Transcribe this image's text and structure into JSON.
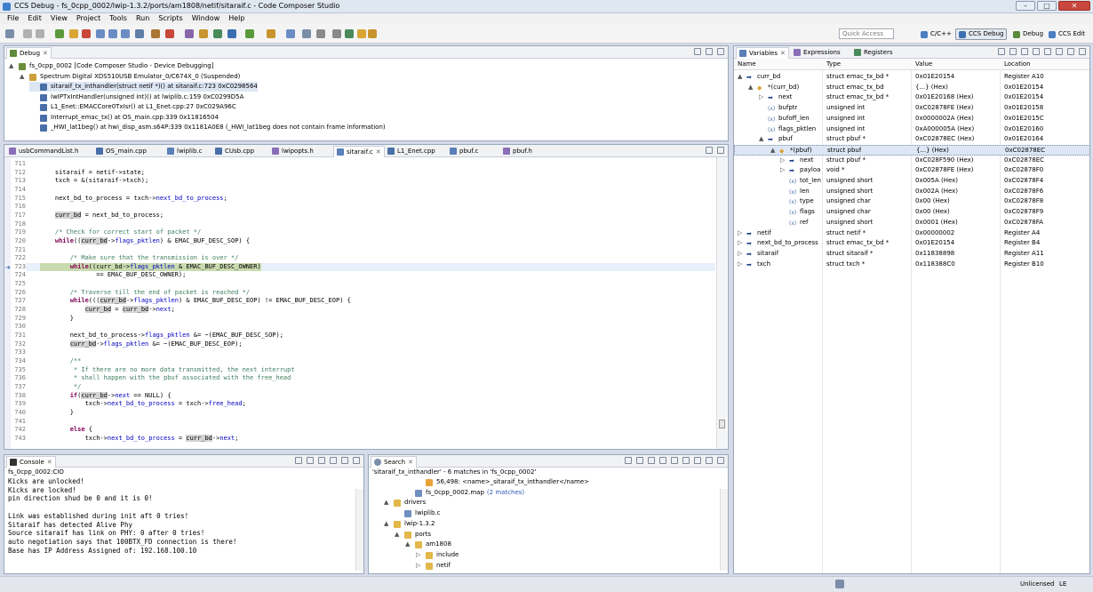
{
  "window": {
    "title": "CCS Debug - fs_0cpp_0002/lwip-1.3.2/ports/am1808/netif/sitaraif.c - Code Composer Studio"
  },
  "menu": [
    "File",
    "Edit",
    "View",
    "Project",
    "Tools",
    "Run",
    "Scripts",
    "Window",
    "Help"
  ],
  "toolbar": {
    "quick_access": "Quick Access",
    "perspectives": [
      {
        "label": "C/C++",
        "icon": "cpp-perspective-icon",
        "color": "#4b7cc0",
        "active": false
      },
      {
        "label": "CCS Debug",
        "icon": "debug-perspective-icon",
        "color": "#3d6fb0",
        "active": true
      },
      {
        "label": "Debug",
        "icon": "bug-icon",
        "color": "#5b8a3a",
        "active": false
      },
      {
        "label": "CCS Edit",
        "icon": "edit-perspective-icon",
        "color": "#4b7cc0",
        "active": false
      }
    ]
  },
  "debug": {
    "tab": "Debug",
    "items": [
      {
        "text": "fs_0cpp_0002 [Code Composer Studio - Device Debugging]",
        "indent": 0,
        "icon": "launch-icon"
      },
      {
        "text": "Spectrum Digital XDS510USB Emulator_0/C674X_0 (Suspended)",
        "indent": 1,
        "icon": "cpu-icon"
      },
      {
        "text": "sitaraif_tx_inthandler(struct netif *)() at sitaraif.c:723 0xC0298564",
        "indent": 2,
        "icon": "stack-frame-icon",
        "selected": true
      },
      {
        "text": "lwIPTxIntHandler(unsigned int)() at lwiplib.c:159 0xC0299D5A",
        "indent": 2,
        "icon": "stack-frame-icon"
      },
      {
        "text": "L1_Enet::EMACCore0TxIsr() at L1_Enet.cpp:27 0xC029A96C",
        "indent": 2,
        "icon": "stack-frame-icon"
      },
      {
        "text": "Interrupt_emac_tx() at OS_main.cpp:339 0x11816504",
        "indent": 2,
        "icon": "stack-frame-icon"
      },
      {
        "text": "_HWI_lat1beg() at hwi_disp_asm.s64P:339 0x1181A0E8  (_HWI_lat1beg does not contain frame information)",
        "indent": 2,
        "icon": "stack-frame-icon"
      }
    ]
  },
  "editor": {
    "tabs": [
      {
        "label": "usbCommandList.h",
        "active": false
      },
      {
        "label": "OS_main.cpp",
        "active": false
      },
      {
        "label": "lwiplib.c",
        "active": false
      },
      {
        "label": "CUsb.cpp",
        "active": false
      },
      {
        "label": "lwipopts.h",
        "active": false
      },
      {
        "label": "sitaraif.c",
        "active": true
      },
      {
        "label": "L1_Enet.cpp",
        "active": false
      },
      {
        "label": "pbuf.c",
        "active": false
      },
      {
        "label": "pbuf.h",
        "active": false
      }
    ],
    "lines": [
      {
        "n": "711",
        "html": ""
      },
      {
        "n": "712",
        "html": "    sitaraif = netif-&gt;state;"
      },
      {
        "n": "713",
        "html": "    txch = &amp;(sitaraif-&gt;txch);"
      },
      {
        "n": "714",
        "html": ""
      },
      {
        "n": "715",
        "html": "    next_bd_to_process = txch-&gt;<span class=\"fld\">next_bd_to_process</span>;"
      },
      {
        "n": "716",
        "html": ""
      },
      {
        "n": "717",
        "html": "    <span class=\"hl\">curr_bd</span> = next_bd_to_process;"
      },
      {
        "n": "718",
        "html": ""
      },
      {
        "n": "719",
        "html": "    <span class=\"cm\">/* Check for correct start of packet */</span>"
      },
      {
        "n": "720",
        "html": "    <span class=\"kw\">while</span>((<span class=\"hl\">curr_bd</span>-&gt;<span class=\"fld\">flags_pktlen</span>) &amp; EMAC_BUF_DESC_SOP) {"
      },
      {
        "n": "721",
        "html": ""
      },
      {
        "n": "722",
        "html": "        <span class=\"cm\">/* Make sure that the transmission is over */</span>"
      },
      {
        "n": "723",
        "html": "        <span class=\"kw\">while</span>((curr_bd-&gt;<span class=\"fld\">flags_pktlen</span> &amp; EMAC_BUF_DESC_OWNER)",
        "current": true
      },
      {
        "n": "724",
        "html": "               == EMAC_BUF_DESC_OWNER);"
      },
      {
        "n": "725",
        "html": ""
      },
      {
        "n": "726",
        "html": "        <span class=\"cm\">/* Traverse till the end of packet is reached */</span>"
      },
      {
        "n": "727",
        "html": "        <span class=\"kw\">while</span>(((<span class=\"hl\">curr_bd</span>-&gt;<span class=\"fld\">flags_pktlen</span>) &amp; EMAC_BUF_DESC_EOP) != EMAC_BUF_DESC_EOP) {"
      },
      {
        "n": "728",
        "html": "            <span class=\"hl\">curr_bd</span> = <span class=\"hl\">curr_bd</span>-&gt;<span class=\"fld\">next</span>;"
      },
      {
        "n": "729",
        "html": "        }"
      },
      {
        "n": "730",
        "html": ""
      },
      {
        "n": "731",
        "html": "        next_bd_to_process-&gt;<span class=\"fld\">flags_pktlen</span> &amp;= ~(EMAC_BUF_DESC_SOP);"
      },
      {
        "n": "732",
        "html": "        <span class=\"hl\">curr_bd</span>-&gt;<span class=\"fld\">flags_pktlen</span> &amp;= ~(EMAC_BUF_DESC_EOP);"
      },
      {
        "n": "733",
        "html": ""
      },
      {
        "n": "734",
        "html": "        <span class=\"cm\">/**</span>"
      },
      {
        "n": "735",
        "html": "<span class=\"cm\">         * If there are no more data transmitted, the next interrupt</span>"
      },
      {
        "n": "736",
        "html": "<span class=\"cm\">         * shall happen with the pbuf associated with the free_head</span>"
      },
      {
        "n": "737",
        "html": "<span class=\"cm\">         */</span>"
      },
      {
        "n": "738",
        "html": "        <span class=\"kw\">if</span>(<span class=\"hl\">curr_bd</span>-&gt;<span class=\"fld\">next</span> == NULL) {"
      },
      {
        "n": "739",
        "html": "            txch-&gt;<span class=\"fld\">next_bd_to_process</span> = txch-&gt;<span class=\"fld\">free_head</span>;"
      },
      {
        "n": "740",
        "html": "        }"
      },
      {
        "n": "741",
        "html": ""
      },
      {
        "n": "742",
        "html": "        <span class=\"kw\">else</span> {"
      },
      {
        "n": "743",
        "html": "            txch-&gt;<span class=\"fld\">next_bd_to_process</span> = <span class=\"hl\">curr_bd</span>-&gt;<span class=\"fld\">next</span>;"
      }
    ]
  },
  "console": {
    "tab": "Console",
    "header": "fs_0cpp_0002:CIO",
    "lines": [
      "Kicks are unlocked!",
      "Kicks are locked!",
      "pin direction shud be 0 and it is 0!",
      "",
      "Link was established during init aft 0 tries!",
      "Sitaraif has detected Alive Phy",
      "Source sitaraif has link on PHY: 0 after 0 tries!",
      "auto negotiation says that 100BTX_FD connection is there!",
      "Base has IP Address Assigned of: 192.168.100.10"
    ]
  },
  "search": {
    "tab": "Search",
    "header": "'sitaraif_tx_inthandler' - 6 matches in 'fs_0cpp_0002'",
    "rows": [
      {
        "text": "56,498: <name>_sitaraif_tx_inthandler</name>",
        "indent": 4,
        "icon": "match-icon"
      },
      {
        "text": "fs_0cpp_0002.map",
        "extra": "(2 matches)",
        "indent": 3,
        "icon": "file-icon"
      },
      {
        "text": "drivers",
        "indent": 1,
        "icon": "folder-icon",
        "expanded": true
      },
      {
        "text": "lwiplib.c",
        "indent": 2,
        "icon": "c-file-icon"
      },
      {
        "text": "lwip-1.3.2",
        "indent": 1,
        "icon": "folder-icon",
        "expanded": true
      },
      {
        "text": "ports",
        "indent": 2,
        "icon": "folder-icon",
        "expanded": true
      },
      {
        "text": "am1808",
        "indent": 3,
        "icon": "folder-icon",
        "expanded": true
      },
      {
        "text": "include",
        "indent": 4,
        "icon": "folder-icon",
        "expanded": false
      },
      {
        "text": "netif",
        "indent": 4,
        "icon": "folder-icon",
        "expanded": false
      }
    ]
  },
  "variables": {
    "tabs": [
      "Variables",
      "Expressions",
      "Registers"
    ],
    "columns": [
      "Name",
      "Type",
      "Value",
      "Location"
    ],
    "rows": [
      {
        "name": "curr_bd",
        "type": "struct emac_tx_bd *",
        "value": "0x01E20154",
        "loc": "Register A10",
        "indent": 0,
        "tw": "▲",
        "icon": "pointer"
      },
      {
        "name": "*(curr_bd)",
        "type": "struct emac_tx_bd",
        "value": "{...} (Hex)",
        "loc": "0x01E20154",
        "indent": 1,
        "tw": "▲",
        "icon": "struct"
      },
      {
        "name": "next",
        "type": "struct emac_tx_bd *",
        "value": "0x01E20168 (Hex)",
        "loc": "0x01E20154",
        "indent": 2,
        "tw": "▷",
        "icon": "pointer"
      },
      {
        "name": "bufptr",
        "type": "unsigned int",
        "value": "0xC02878FE (Hex)",
        "loc": "0x01E20158",
        "indent": 2,
        "tw": "",
        "icon": "field"
      },
      {
        "name": "bufoff_len",
        "type": "unsigned int",
        "value": "0x0000002A (Hex)",
        "loc": "0x01E2015C",
        "indent": 2,
        "tw": "",
        "icon": "field"
      },
      {
        "name": "flags_pktlen",
        "type": "unsigned int",
        "value": "0xA000005A (Hex)",
        "loc": "0x01E20160",
        "indent": 2,
        "tw": "",
        "icon": "field"
      },
      {
        "name": "pbuf",
        "type": "struct pbuf *",
        "value": "0xC02878EC (Hex)",
        "loc": "0x01E20164",
        "indent": 2,
        "tw": "▲",
        "icon": "pointer"
      },
      {
        "name": "*(pbuf)",
        "type": "struct pbuf",
        "value": "{...} (Hex)",
        "loc": "0xC02878EC",
        "indent": 3,
        "tw": "▲",
        "icon": "struct",
        "selected": true
      },
      {
        "name": "next",
        "type": "struct pbuf *",
        "value": "0xC028F590 (Hex)",
        "loc": "0xC02878EC",
        "indent": 4,
        "tw": "▷",
        "icon": "pointer"
      },
      {
        "name": "payloa",
        "type": "void *",
        "value": "0xC02878FE (Hex)",
        "loc": "0xC02878F0",
        "indent": 4,
        "tw": "▷",
        "icon": "pointer"
      },
      {
        "name": "tot_len",
        "type": "unsigned short",
        "value": "0x005A (Hex)",
        "loc": "0xC02878F4",
        "indent": 4,
        "tw": "",
        "icon": "field"
      },
      {
        "name": "len",
        "type": "unsigned short",
        "value": "0x002A (Hex)",
        "loc": "0xC02878F6",
        "indent": 4,
        "tw": "",
        "icon": "field"
      },
      {
        "name": "type",
        "type": "unsigned char",
        "value": "0x00 (Hex)",
        "loc": "0xC02878F8",
        "indent": 4,
        "tw": "",
        "icon": "field"
      },
      {
        "name": "flags",
        "type": "unsigned char",
        "value": "0x00 (Hex)",
        "loc": "0xC02878F9",
        "indent": 4,
        "tw": "",
        "icon": "field"
      },
      {
        "name": "ref",
        "type": "unsigned short",
        "value": "0x0001 (Hex)",
        "loc": "0xC02878FA",
        "indent": 4,
        "tw": "",
        "icon": "field"
      },
      {
        "name": "netif",
        "type": "struct netif *",
        "value": "0x00000002",
        "loc": "Register A4",
        "indent": 0,
        "tw": "▷",
        "icon": "pointer"
      },
      {
        "name": "next_bd_to_process",
        "type": "struct emac_tx_bd *",
        "value": "0x01E20154",
        "loc": "Register B4",
        "indent": 0,
        "tw": "▷",
        "icon": "pointer"
      },
      {
        "name": "sitaraif",
        "type": "struct sitaraif *",
        "value": "0x11838898",
        "loc": "Register A11",
        "indent": 0,
        "tw": "▷",
        "icon": "pointer"
      },
      {
        "name": "txch",
        "type": "struct txch *",
        "value": "0x118388C0",
        "loc": "Register B10",
        "indent": 0,
        "tw": "▷",
        "icon": "pointer"
      }
    ]
  },
  "status": {
    "write_mode": "Unlicensed",
    "line_ending": "LE"
  }
}
